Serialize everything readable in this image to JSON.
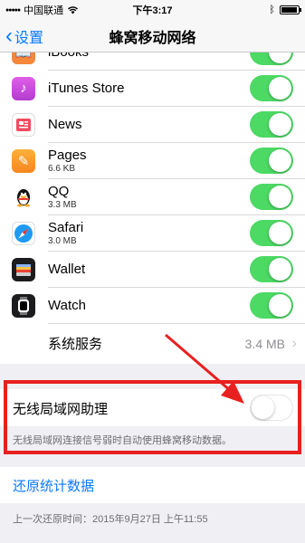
{
  "status_bar": {
    "carrier": "中国联通",
    "time": "下午3:17",
    "battery_level": 0.95
  },
  "nav": {
    "back_label": "设置",
    "title": "蜂窝移动网络"
  },
  "apps": [
    {
      "name": "iBooks",
      "size": "",
      "icon": "ibooks-icon",
      "color": "#f4873a",
      "enabled": true
    },
    {
      "name": "iTunes Store",
      "size": "",
      "icon": "itunes-store-icon",
      "color": "#d84bdc",
      "enabled": true
    },
    {
      "name": "News",
      "size": "",
      "icon": "news-icon",
      "color": "#ffffff",
      "enabled": true
    },
    {
      "name": "Pages",
      "size": "6.6 KB",
      "icon": "pages-icon",
      "color": "#f5961f",
      "enabled": true
    },
    {
      "name": "QQ",
      "size": "3.3 MB",
      "icon": "qq-icon",
      "color": "#ffffff",
      "enabled": true
    },
    {
      "name": "Safari",
      "size": "3.0 MB",
      "icon": "safari-icon",
      "color": "#ffffff",
      "enabled": true
    },
    {
      "name": "Wallet",
      "size": "",
      "icon": "wallet-icon",
      "color": "#1c1c1e",
      "enabled": true
    },
    {
      "name": "Watch",
      "size": "",
      "icon": "watch-icon",
      "color": "#1c1c1e",
      "enabled": true
    }
  ],
  "system_services": {
    "label": "系统服务",
    "value": "3.4 MB"
  },
  "wifi_assist": {
    "label": "无线局域网助理",
    "enabled": false,
    "footer": "无线局域网连接信号弱时自动使用蜂窝移动数据。"
  },
  "reset": {
    "label": "还原统计数据",
    "last_reset": "上一次还原时间：2015年9月27日 上午11:55"
  },
  "colors": {
    "accent": "#0a7aff",
    "toggle_on": "#4cd964",
    "highlight": "#e8201f"
  }
}
